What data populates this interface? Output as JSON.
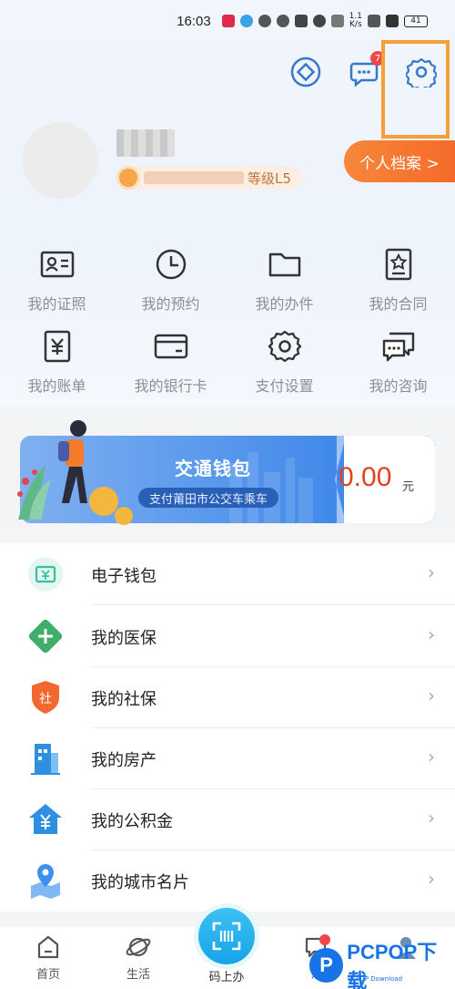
{
  "status_bar": {
    "time": "16:03",
    "speed_value": "1.1",
    "speed_unit": "K/s",
    "battery": "41"
  },
  "header": {
    "message_badge": "7",
    "profile_button": "个人档案 >",
    "level_label": "等级L5"
  },
  "grid": [
    {
      "label": "我的证照",
      "icon": "id-card-icon"
    },
    {
      "label": "我的预约",
      "icon": "clock-icon"
    },
    {
      "label": "我的办件",
      "icon": "folder-icon"
    },
    {
      "label": "我的合同",
      "icon": "contract-icon"
    },
    {
      "label": "我的账单",
      "icon": "bill-icon"
    },
    {
      "label": "我的银行卡",
      "icon": "bank-card-icon"
    },
    {
      "label": "支付设置",
      "icon": "gear-icon"
    },
    {
      "label": "我的咨询",
      "icon": "chat-icon"
    }
  ],
  "wallet": {
    "title": "交通钱包",
    "subtitle": "支付莆田市公交车乘车",
    "amount": "0.00",
    "unit": "元"
  },
  "list": [
    {
      "label": "电子钱包",
      "icon": "wallet-icon",
      "color": "#35c2a0"
    },
    {
      "label": "我的医保",
      "icon": "medical-icon",
      "color": "#3fae6a"
    },
    {
      "label": "我的社保",
      "icon": "social-security-icon",
      "color": "#f2682f"
    },
    {
      "label": "我的房产",
      "icon": "building-icon",
      "color": "#2f8fe0"
    },
    {
      "label": "我的公积金",
      "icon": "housing-fund-icon",
      "color": "#2f8fe0"
    },
    {
      "label": "我的城市名片",
      "icon": "location-icon",
      "color": "#3d8ff0"
    }
  ],
  "tabbar": {
    "home": "首页",
    "life": "生活",
    "scan": "码上办",
    "messages": "消"
  },
  "center_glyph": "[!!]",
  "watermark": {
    "brand": "PCPOP下载",
    "sub": "PCPOP Download",
    "logo_letter": "P"
  },
  "colors": {
    "accent": "#f56a2a",
    "blue": "#2e7de8",
    "highlight": "#f59e3a"
  }
}
